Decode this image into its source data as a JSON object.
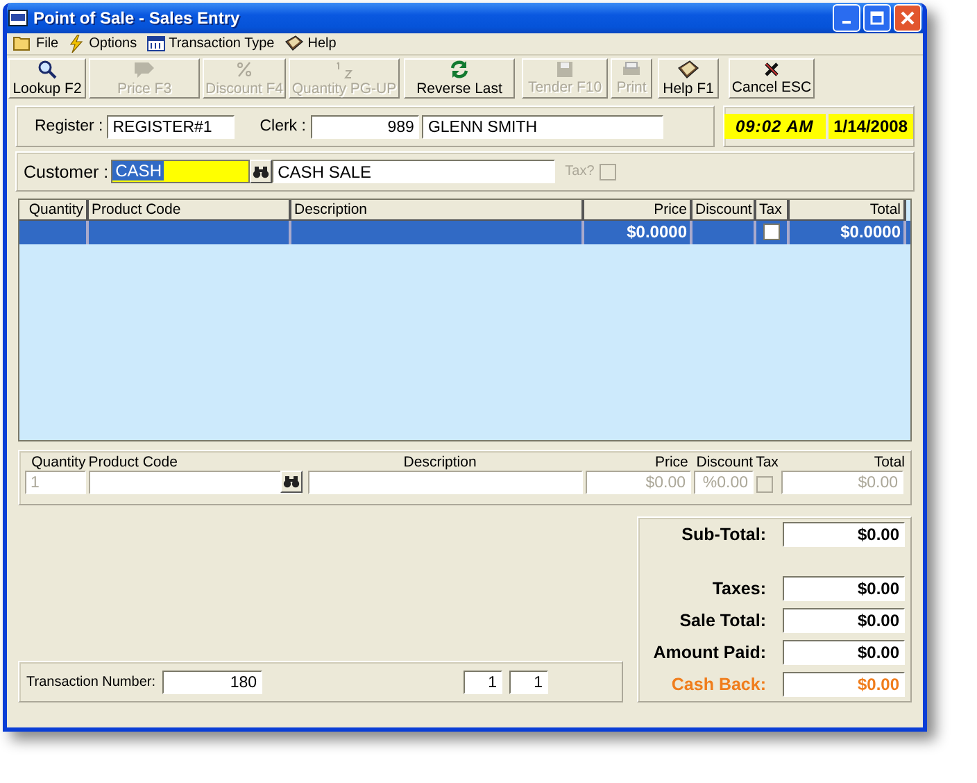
{
  "window": {
    "title": "Point of Sale - Sales Entry"
  },
  "menu": [
    {
      "label": "File"
    },
    {
      "label": "Options"
    },
    {
      "label": "Transaction Type"
    },
    {
      "label": "Help"
    }
  ],
  "toolbar": [
    {
      "label": "Lookup F2",
      "disabled": false
    },
    {
      "label": "Price F3",
      "disabled": true
    },
    {
      "label": "Discount F4",
      "disabled": true
    },
    {
      "label": "Quantity PG-UP",
      "disabled": true
    },
    {
      "label": "Reverse Last",
      "disabled": false
    },
    {
      "label": "Tender F10",
      "disabled": true
    },
    {
      "label": "Print",
      "disabled": true
    },
    {
      "label": "Help F1",
      "disabled": false
    },
    {
      "label": "Cancel ESC",
      "disabled": false
    }
  ],
  "register": {
    "label": "Register :",
    "value": "REGISTER#1"
  },
  "clerk": {
    "label": "Clerk :",
    "id": "989",
    "name": "GLENN SMITH"
  },
  "clock": {
    "time": "09:02 AM",
    "date": "1/14/2008"
  },
  "customer": {
    "label": "Customer :",
    "code": "CASH",
    "name": "CASH SALE",
    "tax_label": "Tax?",
    "tax_checked": false
  },
  "grid": {
    "columns": [
      "Quantity",
      "Product Code",
      "Description",
      "Price",
      "Discount",
      "Tax",
      "Total"
    ],
    "rows": [
      {
        "quantity": "",
        "product_code": "",
        "description": "",
        "price": "$0.0000",
        "discount": "",
        "tax": false,
        "total": "$0.0000",
        "selected": true
      }
    ]
  },
  "entry": {
    "columns": [
      "Quantity",
      "Product Code",
      "Description",
      "Price",
      "Discount",
      "Tax",
      "Total"
    ],
    "quantity": "1",
    "price": "$0.00",
    "discount": "%0.00",
    "tax": false,
    "total": "$0.00"
  },
  "transaction": {
    "label": "Transaction Number:",
    "number": "180",
    "page": "1",
    "pages": "1"
  },
  "totals": [
    {
      "label": "Sub-Total:",
      "value": "$0.00",
      "kind": "normal"
    },
    {
      "label": "Taxes:",
      "value": "$0.00",
      "kind": "normal"
    },
    {
      "label": "Sale Total:",
      "value": "$0.00",
      "kind": "normal"
    },
    {
      "label": "Amount Paid:",
      "value": "$0.00",
      "kind": "normal"
    },
    {
      "label": "Cash Back:",
      "value": "$0.00",
      "kind": "change"
    }
  ]
}
